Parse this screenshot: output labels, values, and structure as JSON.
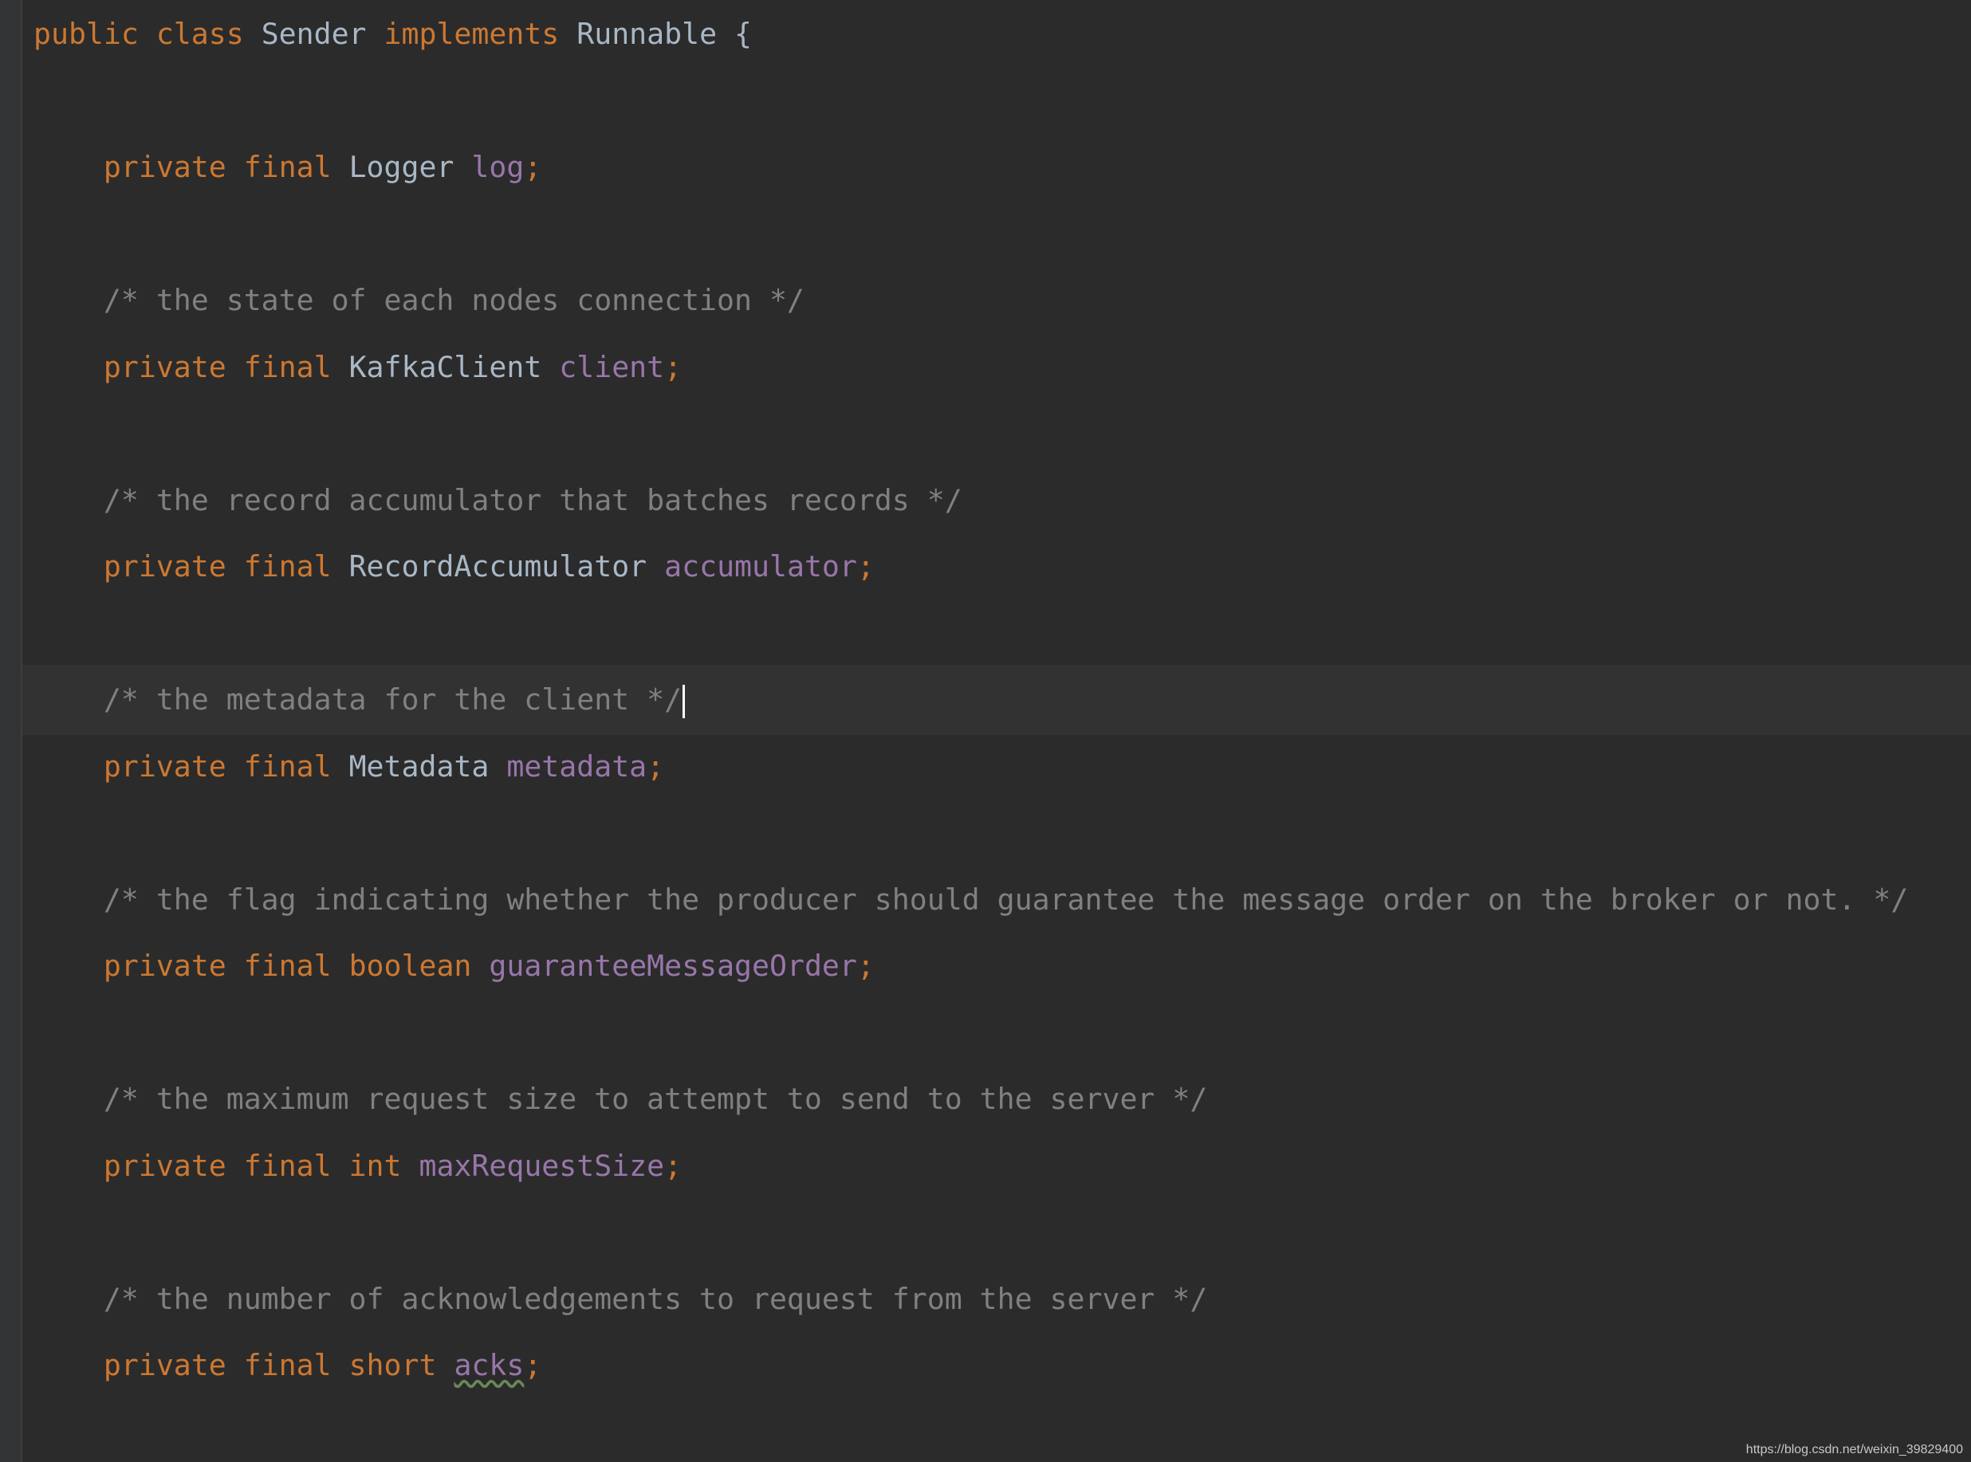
{
  "editor": {
    "lines": [
      {
        "indent": "",
        "tokens": [
          {
            "t": "kw",
            "v": "public "
          },
          {
            "t": "kw",
            "v": "class "
          },
          {
            "t": "type",
            "v": "Sender "
          },
          {
            "t": "kw",
            "v": "implements "
          },
          {
            "t": "type",
            "v": "Runnable {"
          }
        ]
      },
      {
        "indent": "",
        "tokens": []
      },
      {
        "indent": "    ",
        "tokens": [
          {
            "t": "kw",
            "v": "private "
          },
          {
            "t": "kw",
            "v": "final "
          },
          {
            "t": "type",
            "v": "Logger "
          },
          {
            "t": "field",
            "v": "log"
          },
          {
            "t": "semi",
            "v": ";"
          }
        ]
      },
      {
        "indent": "",
        "tokens": []
      },
      {
        "indent": "    ",
        "tokens": [
          {
            "t": "comment",
            "v": "/* the state of each nodes connection */"
          }
        ]
      },
      {
        "indent": "    ",
        "tokens": [
          {
            "t": "kw",
            "v": "private "
          },
          {
            "t": "kw",
            "v": "final "
          },
          {
            "t": "type",
            "v": "KafkaClient "
          },
          {
            "t": "field",
            "v": "client"
          },
          {
            "t": "semi",
            "v": ";"
          }
        ]
      },
      {
        "indent": "",
        "tokens": []
      },
      {
        "indent": "    ",
        "tokens": [
          {
            "t": "comment",
            "v": "/* the record accumulator that batches records */"
          }
        ]
      },
      {
        "indent": "    ",
        "tokens": [
          {
            "t": "kw",
            "v": "private "
          },
          {
            "t": "kw",
            "v": "final "
          },
          {
            "t": "type",
            "v": "RecordAccumulator "
          },
          {
            "t": "field",
            "v": "accumulator"
          },
          {
            "t": "semi",
            "v": ";"
          }
        ]
      },
      {
        "indent": "",
        "tokens": []
      },
      {
        "indent": "    ",
        "current": true,
        "caret": true,
        "tokens": [
          {
            "t": "comment",
            "v": "/* the metadata for the client */"
          }
        ]
      },
      {
        "indent": "    ",
        "tokens": [
          {
            "t": "kw",
            "v": "private "
          },
          {
            "t": "kw",
            "v": "final "
          },
          {
            "t": "type",
            "v": "Metadata "
          },
          {
            "t": "field",
            "v": "metadata"
          },
          {
            "t": "semi",
            "v": ";"
          }
        ]
      },
      {
        "indent": "",
        "tokens": []
      },
      {
        "indent": "    ",
        "tokens": [
          {
            "t": "comment",
            "v": "/* the flag indicating whether the producer should guarantee the message order on the broker or not. */"
          }
        ]
      },
      {
        "indent": "    ",
        "tokens": [
          {
            "t": "kw",
            "v": "private "
          },
          {
            "t": "kw",
            "v": "final "
          },
          {
            "t": "kw",
            "v": "boolean "
          },
          {
            "t": "field",
            "v": "guaranteeMessageOrder"
          },
          {
            "t": "semi",
            "v": ";"
          }
        ]
      },
      {
        "indent": "",
        "tokens": []
      },
      {
        "indent": "    ",
        "tokens": [
          {
            "t": "comment",
            "v": "/* the maximum request size to attempt to send to the server */"
          }
        ]
      },
      {
        "indent": "    ",
        "tokens": [
          {
            "t": "kw",
            "v": "private "
          },
          {
            "t": "kw",
            "v": "final "
          },
          {
            "t": "kw",
            "v": "int "
          },
          {
            "t": "field",
            "v": "maxRequestSize"
          },
          {
            "t": "semi",
            "v": ";"
          }
        ]
      },
      {
        "indent": "",
        "tokens": []
      },
      {
        "indent": "    ",
        "tokens": [
          {
            "t": "comment",
            "v": "/* the number of acknowledgements to request from the server */"
          }
        ]
      },
      {
        "indent": "    ",
        "tokens": [
          {
            "t": "kw",
            "v": "private "
          },
          {
            "t": "kw",
            "v": "final "
          },
          {
            "t": "kw",
            "v": "short "
          },
          {
            "t": "field",
            "v": "acks",
            "squiggle": true
          },
          {
            "t": "semi",
            "v": ";"
          }
        ]
      }
    ]
  },
  "watermark": "https://blog.csdn.net/weixin_39829400",
  "colors": {
    "background": "#2b2b2b",
    "current_line": "#323232",
    "keyword": "#cc7832",
    "type": "#a9b7c6",
    "field": "#9876aa",
    "comment": "#808080"
  }
}
